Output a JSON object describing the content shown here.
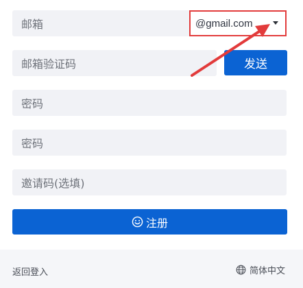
{
  "form": {
    "email_placeholder": "邮箱",
    "email_domain": "@gmail.com",
    "code_placeholder": "邮箱验证码",
    "send_label": "发送",
    "password_placeholder": "密码",
    "confirm_password_placeholder": "密码",
    "invite_placeholder": "邀请码(选填)",
    "register_label": "注册"
  },
  "footer": {
    "back_label": "返回登入",
    "language_label": "简体中文"
  },
  "colors": {
    "primary": "#0b63d3",
    "field_bg": "#f1f2f6",
    "highlight": "#e23b3b"
  },
  "icons": {
    "register": "smile-icon",
    "language": "globe-icon",
    "dropdown": "caret-down-icon"
  }
}
